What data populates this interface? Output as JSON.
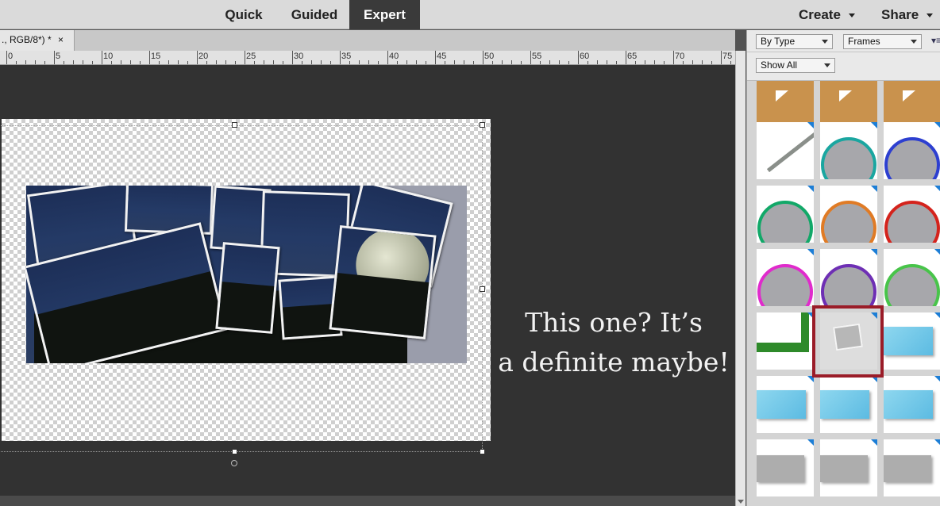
{
  "header": {
    "modes": [
      {
        "label": "Quick",
        "active": false
      },
      {
        "label": "Guided",
        "active": false
      },
      {
        "label": "Expert",
        "active": true
      }
    ],
    "create_label": "Create",
    "share_label": "Share"
  },
  "document": {
    "tab_title": "., RGB/8*) *",
    "close_glyph": "×"
  },
  "ruler": {
    "labels": [
      "0",
      "5",
      "10",
      "15",
      "20",
      "25",
      "30",
      "35",
      "40",
      "45",
      "50",
      "55",
      "60",
      "65",
      "70",
      "75"
    ]
  },
  "caption": {
    "line1": "This one? It’s",
    "line2": "a definite maybe!"
  },
  "panel": {
    "filter_type": "By Type",
    "filter_category": "Frames",
    "show_filter": "Show All",
    "menu_icon": "panel-menu-icon",
    "selected_index": 13,
    "thumbnails": [
      "leather-stitch-frame",
      "leather-stitch-frame",
      "leather-stitch-frame",
      "silver-branch-frame",
      "teal-ring-frame",
      "blue-ring-frame",
      "green-ring-frame",
      "orange-ring-frame",
      "red-ring-frame",
      "magenta-ring-frame",
      "purple-ring-frame",
      "lime-ring-frame",
      "leaf-garland-frame",
      "stacked-photos-frame",
      "cyan-rect-frame",
      "cyan-shadow-frame",
      "blue-gradient-frame",
      "blue-tilted-frame",
      "grey-photo-frame",
      "grey-shadow-frame",
      "grey-curl-frame"
    ]
  },
  "colors": {
    "accent_selection": "#9a1c28",
    "active_mode_bg": "#3a3a3a",
    "workspace_bg": "#323232"
  }
}
